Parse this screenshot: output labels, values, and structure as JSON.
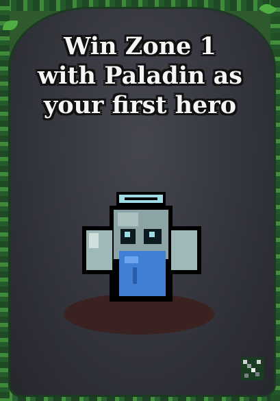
{
  "achievement": {
    "title": "Win Zone 1\nwith Paladin as\nyour first hero"
  },
  "icons": {
    "corner": "crossed-swords-icon",
    "hero": "paladin-ghost-sprite",
    "halo": "halo-icon"
  },
  "colors": {
    "panel": "#36373f",
    "vine": "#3f8a3a",
    "hero_body": "#3f7fd6",
    "hero_head": "#8fa5a8",
    "halo": "#8ad3e0",
    "text": "#f5f5f5"
  }
}
